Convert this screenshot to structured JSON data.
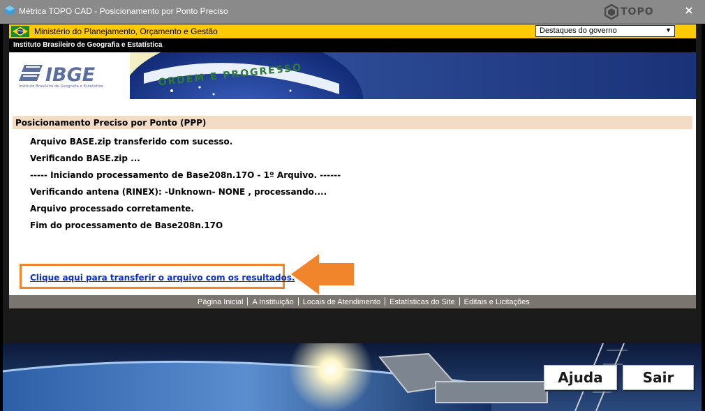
{
  "window": {
    "title": "Métrica TOPO CAD - Posicionamento por Ponto Preciso",
    "logo_text": "TOPO",
    "close_label": "×"
  },
  "gov_bar": {
    "ministry": "Ministério do Planejamento, Orçamento e Gestão",
    "select_value": "Destaques do governo"
  },
  "institute_label": "Instituto Brasileiro de Geografia e Estatística",
  "banner": {
    "logo_text": "IBGE",
    "logo_subtext": "Instituto Brasileiro de Geografia e Estatística",
    "flag_motto": "ORDEM E PROGRESSO"
  },
  "content": {
    "section_title": "Posicionamento Preciso por Ponto (PPP)",
    "lines": [
      "Arquivo BASE.zip transferido com sucesso.",
      "Verificando BASE.zip ...",
      "----- Iniciando processamento de Base208n.17O - 1º Arquivo. ------",
      "Verificando antena (RINEX): -Unknown- NONE , processando....",
      "Arquivo processado corretamente.",
      "Fim do processamento de Base208n.17O"
    ],
    "result_link": "Clique aqui para transferir o arquivo com os resultados."
  },
  "footer_links": [
    "Página Inicial",
    "A Instituição",
    "Locais de Atendimento",
    "Estatísticas do Site",
    "Editais e Licitações"
  ],
  "buttons": {
    "help": "Ajuda",
    "exit": "Sair"
  },
  "colors": {
    "gov_yellow": "#fdcb00",
    "section_bg": "#f4dbc3",
    "highlight_orange": "#f0852b",
    "link_blue": "#0b2dc8",
    "banner_blue": "#1d3a86"
  }
}
